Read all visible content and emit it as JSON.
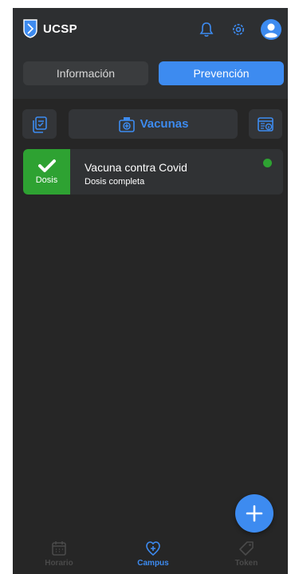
{
  "app": {
    "name": "UCSP"
  },
  "header": {
    "bell_icon": "bell-icon",
    "settings_icon": "gear-icon",
    "avatar_icon": "user-avatar-icon"
  },
  "tabs": {
    "info_label": "Información",
    "prevention_label": "Prevención",
    "active": "Prevención"
  },
  "toolbar": {
    "left_icon": "checklist-icon",
    "center_label": "Vacunas",
    "center_icon": "vaccine-kit-icon",
    "right_icon": "record-info-icon"
  },
  "vaccine_card": {
    "badge_label": "Dosis",
    "title": "Vacuna contra Covid",
    "subtitle": "Dosis completa",
    "status_color": "#2ea232"
  },
  "fab": {
    "icon": "plus-icon"
  },
  "bottom_nav": {
    "items": [
      {
        "label": "Horario",
        "icon": "calendar-icon",
        "active": false
      },
      {
        "label": "Campus",
        "icon": "heart-shield-icon",
        "active": true
      },
      {
        "label": "Token",
        "icon": "tag-icon",
        "active": false
      }
    ]
  },
  "colors": {
    "accent": "#3d8bf0",
    "success": "#2ea232",
    "background": "#262626"
  }
}
